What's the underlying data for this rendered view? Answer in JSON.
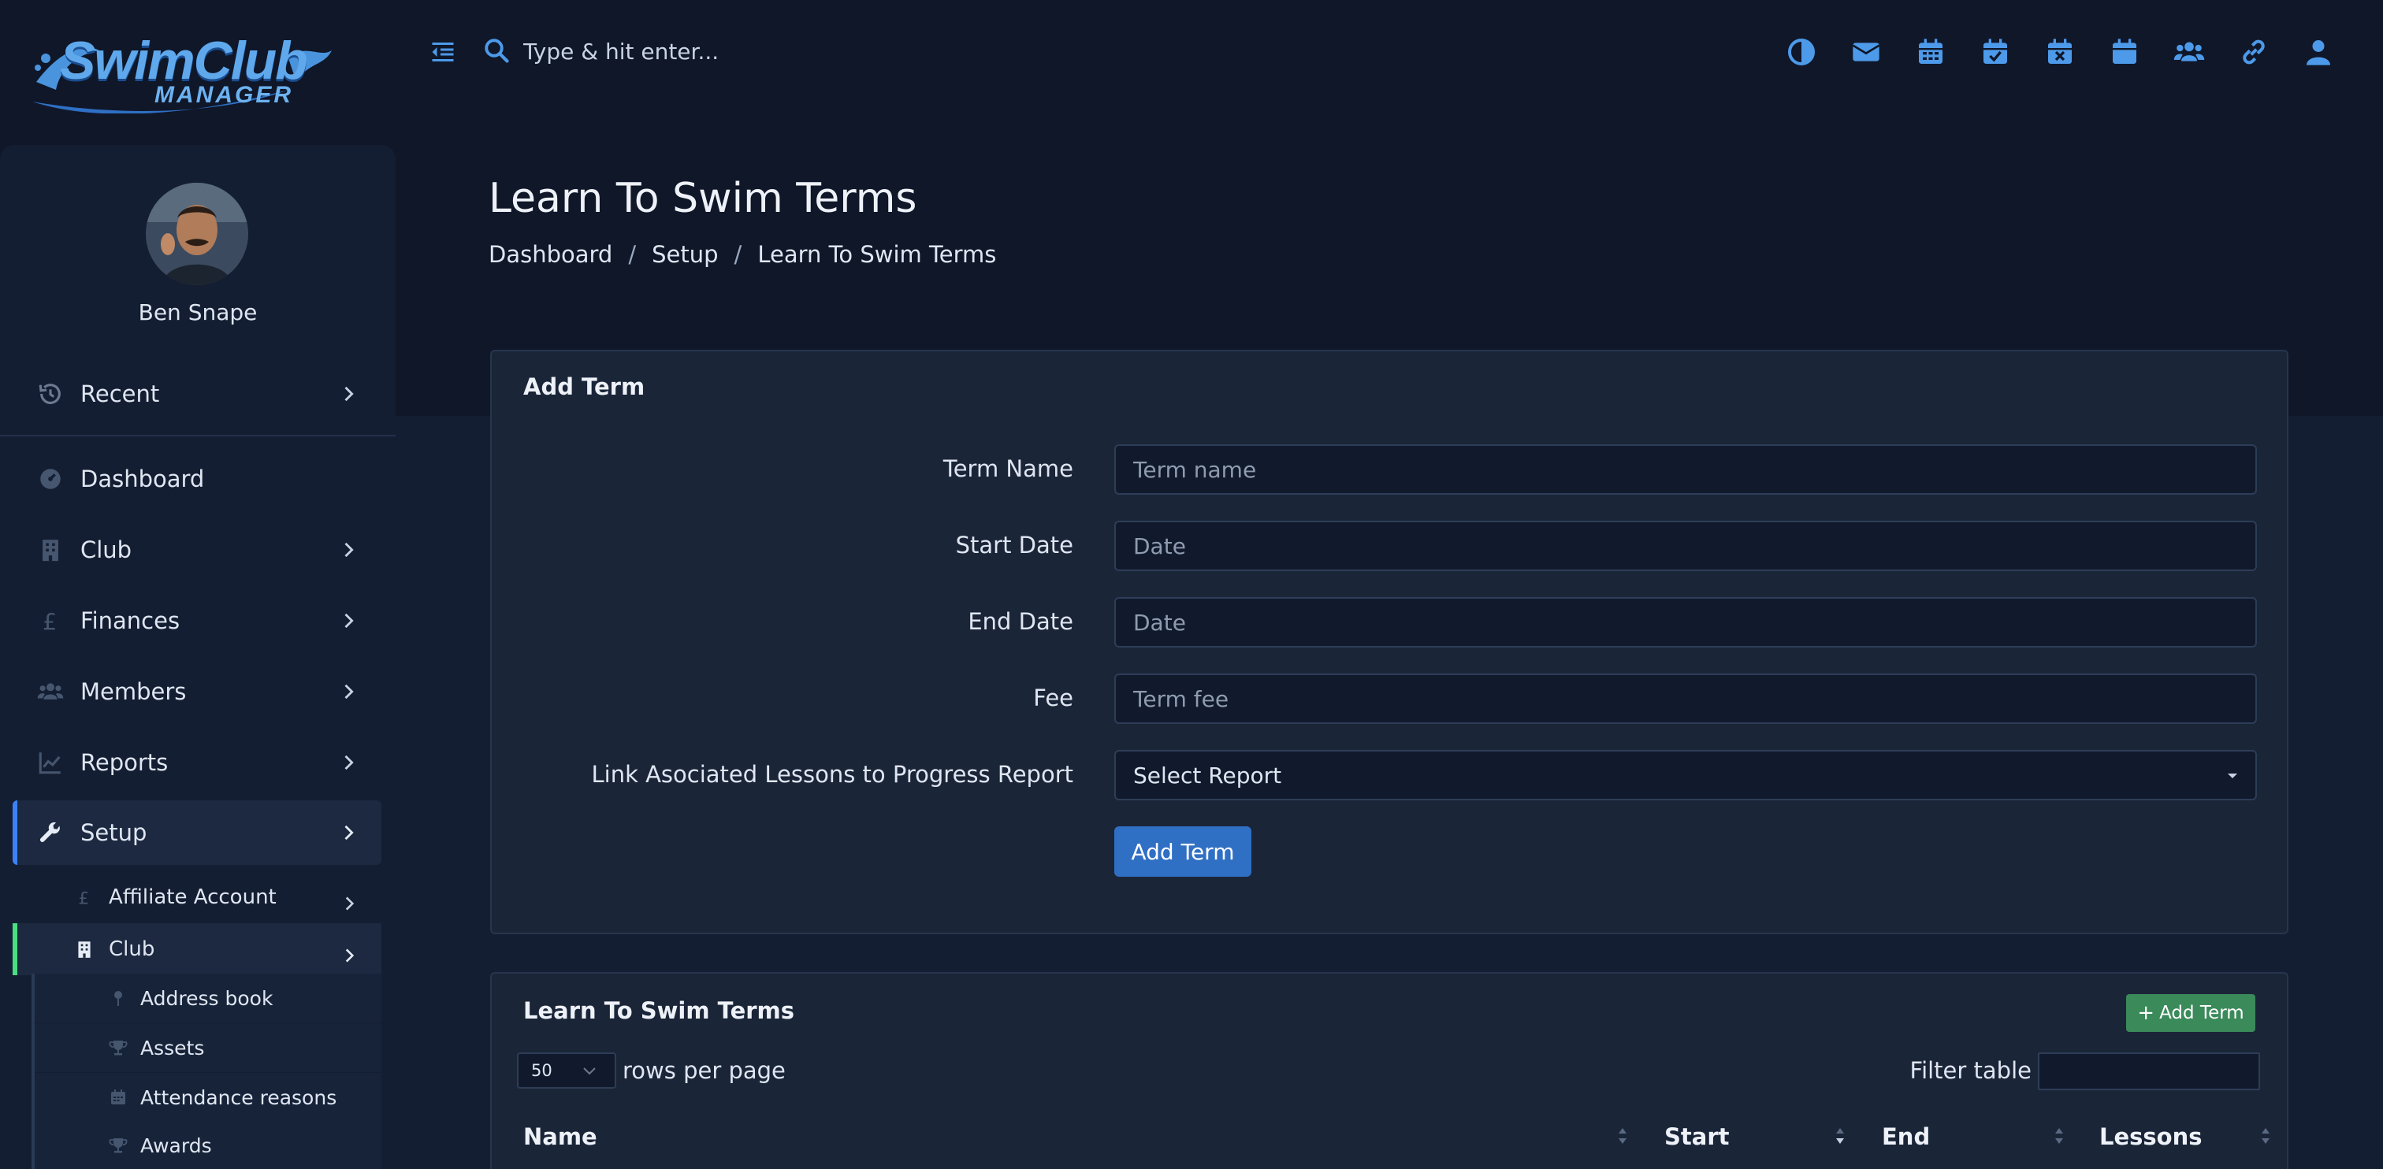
{
  "app": {
    "logo_main": "SwimClub",
    "logo_sub": "MANAGER"
  },
  "search": {
    "placeholder": "Type & hit enter..."
  },
  "top_icons": [
    "contrast-icon",
    "envelope-icon",
    "calendar-grid-icon",
    "calendar-check-icon",
    "calendar-x-icon",
    "calendar-icon",
    "users-icon",
    "link-icon",
    "user-icon"
  ],
  "user": {
    "name": "Ben Snape"
  },
  "sidebar": {
    "recent": "Recent",
    "items": [
      {
        "label": "Dashboard",
        "icon": "dashboard-icon"
      },
      {
        "label": "Club",
        "icon": "building-icon"
      },
      {
        "label": "Finances",
        "icon": "pound-icon"
      },
      {
        "label": "Members",
        "icon": "users-icon"
      },
      {
        "label": "Reports",
        "icon": "chart-line-icon"
      },
      {
        "label": "Setup",
        "icon": "wrench-icon"
      }
    ],
    "setup_sub": [
      {
        "label": "Affiliate Account",
        "icon": "pound-icon"
      },
      {
        "label": "Club",
        "icon": "building-icon"
      }
    ],
    "club_sub": [
      {
        "label": "Address book",
        "icon": "pin-icon"
      },
      {
        "label": "Assets",
        "icon": "trophy-icon"
      },
      {
        "label": "Attendance reasons",
        "icon": "calendar-icon"
      },
      {
        "label": "Awards",
        "icon": "trophy-icon"
      }
    ]
  },
  "page": {
    "title": "Learn To Swim Terms",
    "breadcrumb": [
      "Dashboard",
      "Setup",
      "Learn To Swim Terms"
    ]
  },
  "add_form": {
    "title": "Add Term",
    "term_name_label": "Term Name",
    "term_name_placeholder": "Term name",
    "start_date_label": "Start Date",
    "start_date_placeholder": "Date",
    "end_date_label": "End Date",
    "end_date_placeholder": "Date",
    "fee_label": "Fee",
    "fee_placeholder": "Term fee",
    "report_label": "Link Asociated Lessons to Progress Report",
    "report_value": "Select Report",
    "submit_label": "Add Term"
  },
  "terms_table": {
    "title": "Learn To Swim Terms",
    "add_button": "Add Term",
    "rows_per_page_value": "50",
    "rows_per_page_label": "rows per page",
    "filter_label": "Filter table",
    "columns": [
      "Name",
      "Start",
      "End",
      "Lessons"
    ]
  },
  "colors": {
    "background": "#0f1729",
    "sidebar": "#141e32",
    "accent": "#3b82f6",
    "primary_button": "#2f6fc4",
    "success_button": "#3b8a5a"
  }
}
